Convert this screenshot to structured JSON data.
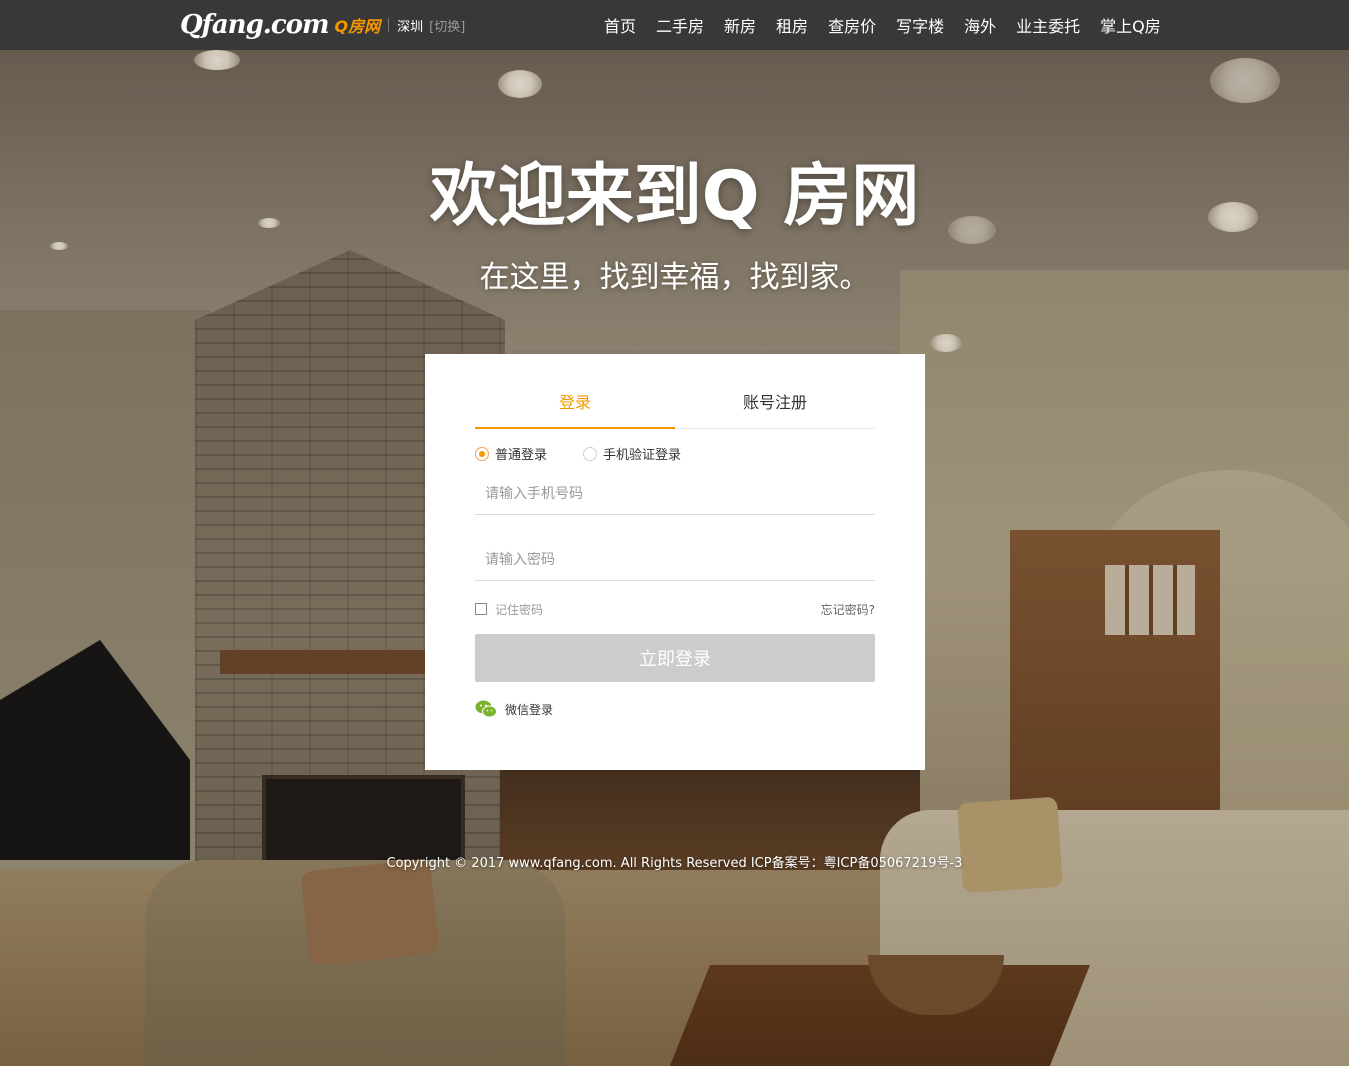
{
  "header": {
    "logo_text": "Qfang.com",
    "logo_cn": "Q房网",
    "city": "深圳",
    "city_switch": "[切换]",
    "nav": [
      "首页",
      "二手房",
      "新房",
      "租房",
      "查房价",
      "写字楼",
      "海外",
      "业主委托",
      "掌上Q房"
    ]
  },
  "hero": {
    "title": "欢迎来到Q 房网",
    "subtitle": "在这里，找到幸福，找到家。"
  },
  "login": {
    "tabs": [
      "登录",
      "账号注册"
    ],
    "active_tab": "登录",
    "mode_options": [
      "普通登录",
      "手机验证登录"
    ],
    "selected_mode": "普通登录",
    "phone_placeholder": "请输入手机号码",
    "password_placeholder": "请输入密码",
    "remember_label": "记住密码",
    "forgot_label": "忘记密码?",
    "submit_label": "立即登录",
    "wechat_label": "微信登录"
  },
  "footer": {
    "copyright": "Copyright © 2017 www.qfang.com. All Rights Reserved ICP备案号：粤ICP备05067219号-3"
  },
  "colors": {
    "accent": "#f39800",
    "topbar": "#383838",
    "submit_disabled": "#cccccc",
    "wechat": "#7bb32e"
  }
}
